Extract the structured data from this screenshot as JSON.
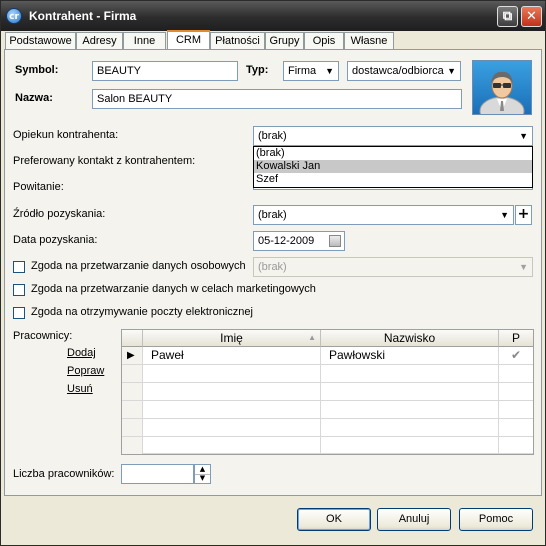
{
  "window": {
    "title": "Kontrahent - Firma",
    "app_icon": "app-logo-icon"
  },
  "tabs": [
    "Podstawowe",
    "Adresy",
    "Inne",
    "CRM",
    "Płatności",
    "Grupy",
    "Opis",
    "Własne"
  ],
  "active_tab": "CRM",
  "header": {
    "symbol_label": "Symbol:",
    "symbol_value": "BEAUTY",
    "typ_label": "Typ:",
    "typ_value": "Firma",
    "typ2_value": "dostawca/odbiorca",
    "nazwa_label": "Nazwa:",
    "nazwa_value": "Salon BEAUTY"
  },
  "crm": {
    "opiekun_label": "Opiekun kontrahenta:",
    "opiekun_value": "(brak)",
    "preferowany_label": "Preferowany kontakt z kontrahentem:",
    "powitanie_label": "Powitanie:",
    "zrodlo_label": "Źródło pozyskania:",
    "zrodlo_value": "(brak)",
    "data_label": "Data pozyskania:",
    "data_value": "05-12-2009",
    "zgoda1_label": "Zgoda na przetwarzanie danych osobowych",
    "zgoda1_value": "(brak)",
    "zgoda2_label": "Zgoda na przetwarzanie danych w celach marketingowych",
    "zgoda3_label": "Zgoda na otrzymywanie poczty elektronicznej"
  },
  "dropdown_options": [
    "(brak)",
    "Kowalski Jan",
    "Szef"
  ],
  "dropdown_selected_index": 1,
  "employees": {
    "label": "Pracownicy:",
    "actions": [
      "Dodaj",
      "Popraw",
      "Usuń"
    ],
    "columns": [
      "Imię",
      "Nazwisko",
      "P"
    ],
    "rows": [
      {
        "imie": "Paweł",
        "nazwisko": "Pawłowski",
        "p": "✔"
      }
    ],
    "count_label": "Liczba pracowników:",
    "count_value": ""
  },
  "footer": {
    "ok": "OK",
    "cancel": "Anuluj",
    "help": "Pomoc"
  },
  "colors": {
    "titlebar": "#2c2c2c",
    "close_button": "#c0311a",
    "active_tab_accent": "#e68b2c"
  }
}
